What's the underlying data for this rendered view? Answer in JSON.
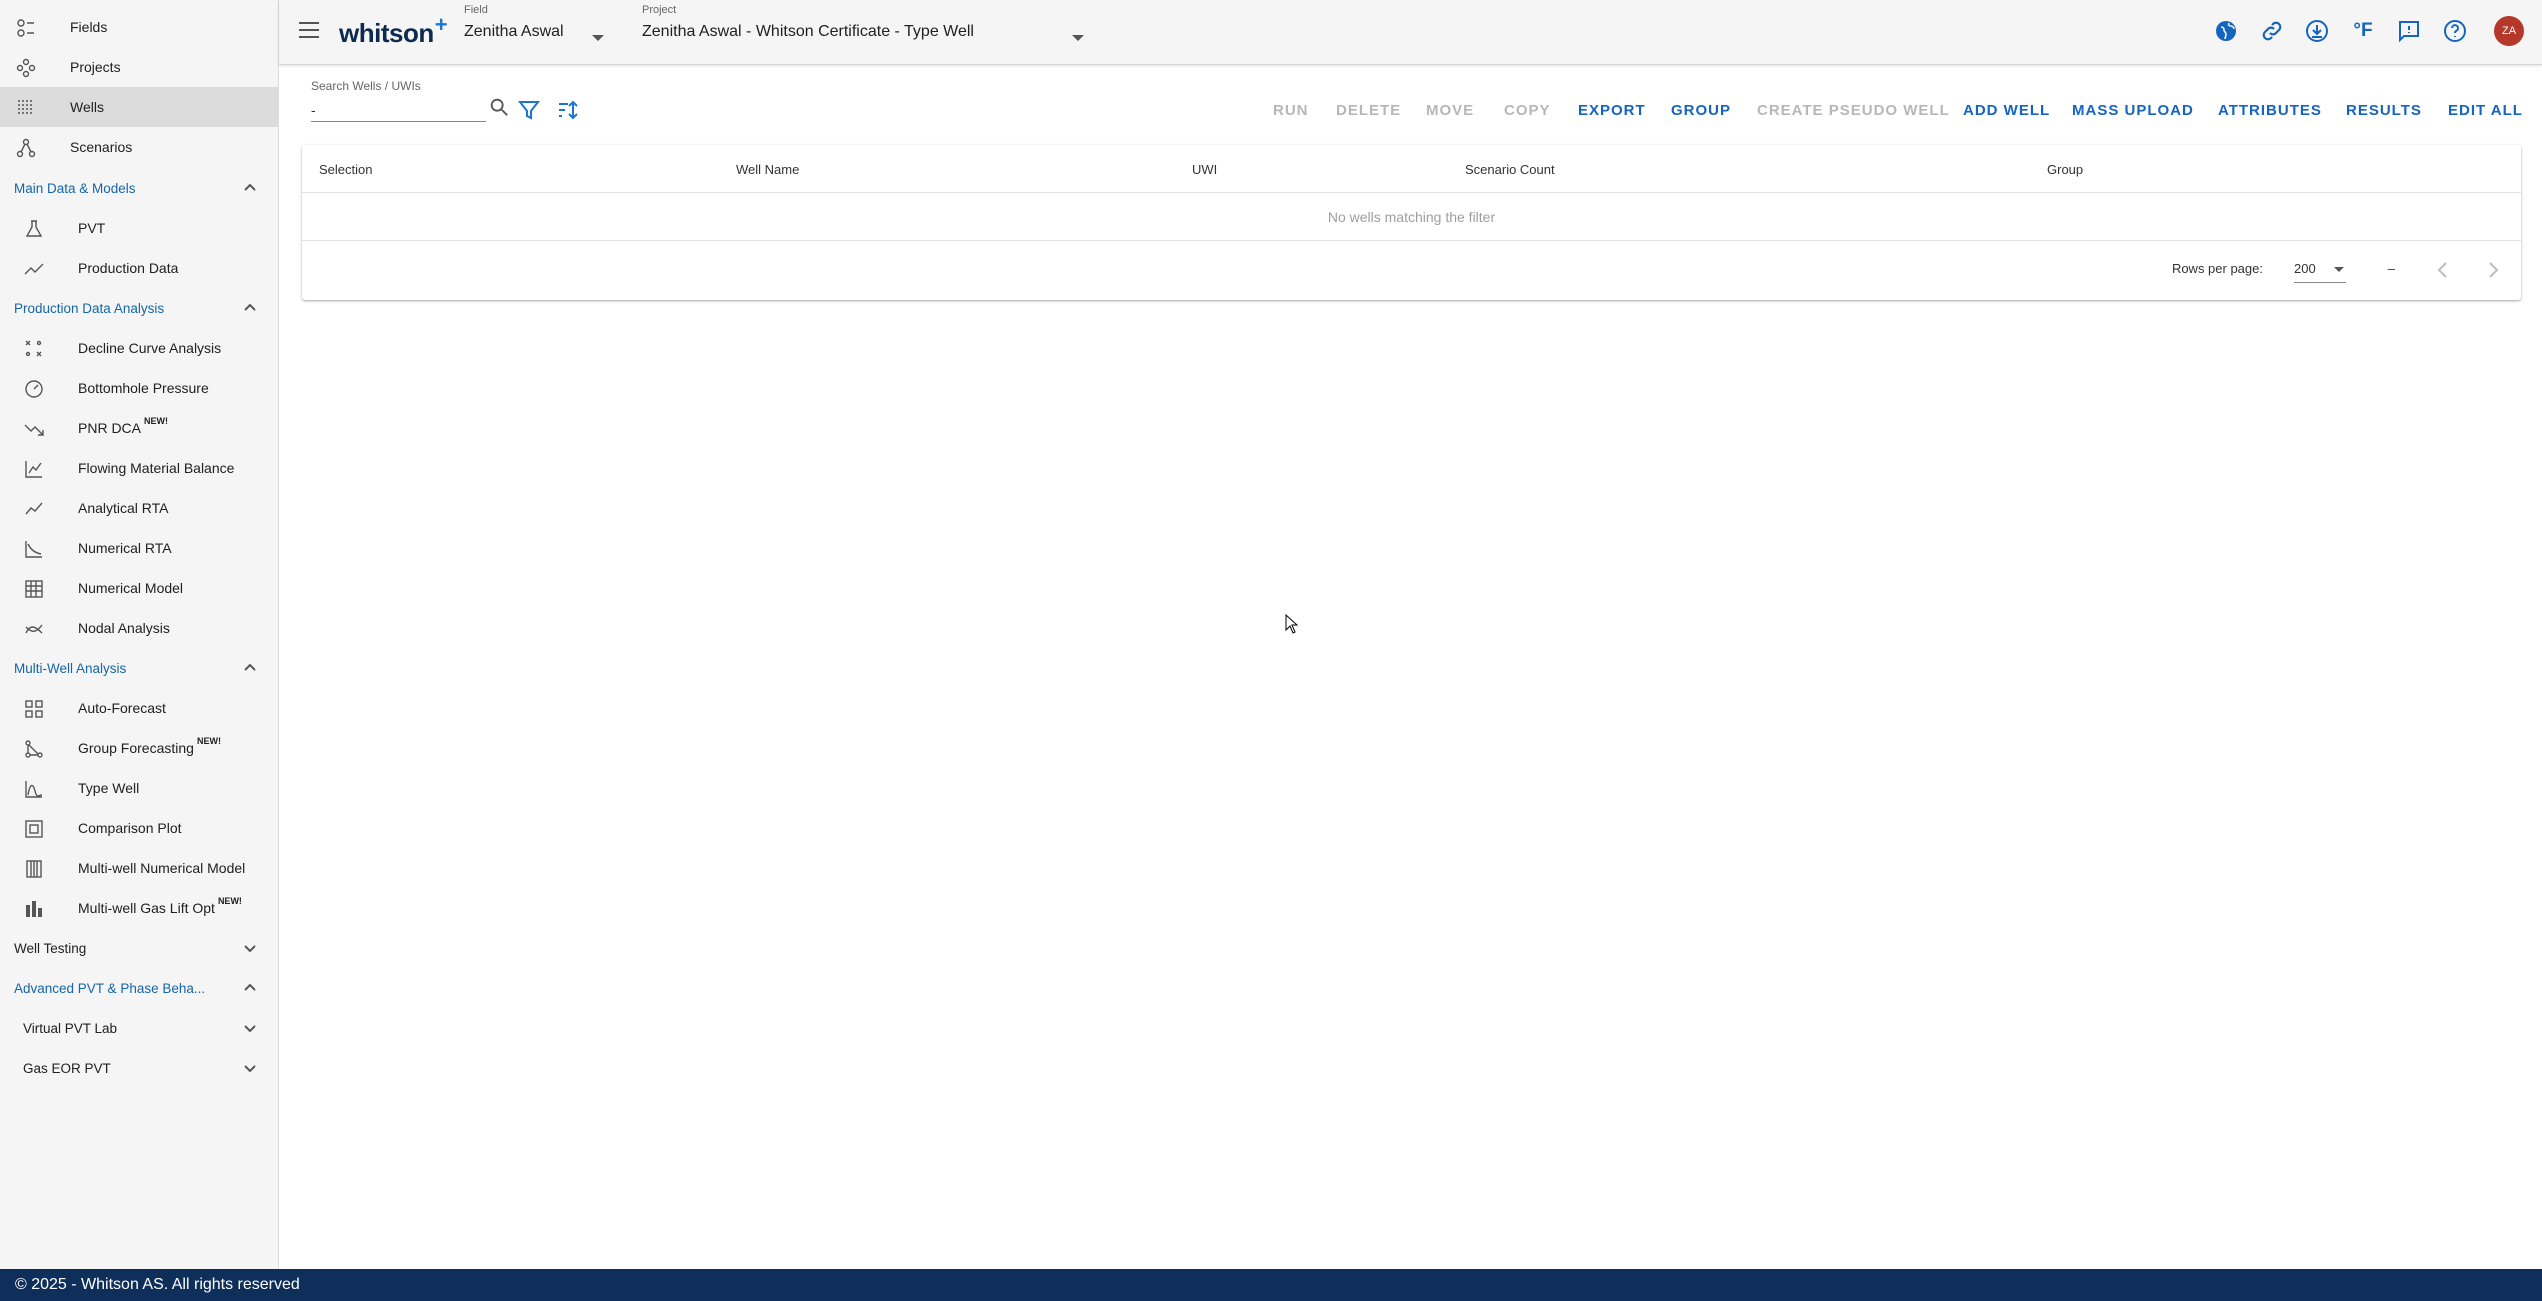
{
  "sidebar": {
    "top_items": [
      {
        "label": "Fields",
        "icon": "fields-icon"
      },
      {
        "label": "Projects",
        "icon": "projects-icon"
      },
      {
        "label": "Wells",
        "icon": "wells-icon",
        "active": true
      },
      {
        "label": "Scenarios",
        "icon": "scenarios-icon"
      }
    ],
    "sections": {
      "main": {
        "title": "Main Data & Models",
        "items": [
          "PVT",
          "Production Data"
        ]
      },
      "pda": {
        "title": "Production Data Analysis",
        "items": [
          "Decline Curve Analysis",
          "Bottomhole Pressure",
          "PNR DCA",
          "Flowing Material Balance",
          "Analytical RTA",
          "Numerical RTA",
          "Numerical Model",
          "Nodal Analysis"
        ]
      },
      "mwa": {
        "title": "Multi-Well Analysis",
        "items": [
          "Auto-Forecast",
          "Group Forecasting",
          "Type Well",
          "Comparison Plot",
          "Multi-well Numerical Model",
          "Multi-well Gas Lift Opt"
        ]
      },
      "well_testing": {
        "title": "Well Testing"
      },
      "adv_pvt": {
        "title": "Advanced PVT & Phase Beha..."
      },
      "virtual_pvt": {
        "title": "Virtual PVT Lab"
      },
      "gas_eor": {
        "title": "Gas EOR PVT"
      }
    },
    "new_badge": "NEW!"
  },
  "header": {
    "logo": "whitson",
    "logo_plus": "+",
    "field_label": "Field",
    "field_value": "Zenitha Aswal",
    "project_label": "Project",
    "project_value": "Zenitha Aswal - Whitson Certificate - Type Well",
    "temp_unit": "°F",
    "avatar": "ZA"
  },
  "toolbar": {
    "search_label": "Search Wells / UWIs",
    "search_value": "-",
    "actions": [
      {
        "label": "RUN",
        "enabled": false
      },
      {
        "label": "DELETE",
        "enabled": false
      },
      {
        "label": "MOVE",
        "enabled": false
      },
      {
        "label": "COPY",
        "enabled": false
      },
      {
        "label": "EXPORT",
        "enabled": true
      },
      {
        "label": "GROUP",
        "enabled": true
      },
      {
        "label": "CREATE PSEUDO WELL",
        "enabled": false
      },
      {
        "label": "ADD WELL",
        "enabled": true
      },
      {
        "label": "MASS UPLOAD",
        "enabled": true
      },
      {
        "label": "ATTRIBUTES",
        "enabled": true
      },
      {
        "label": "RESULTS",
        "enabled": true
      },
      {
        "label": "EDIT ALL",
        "enabled": true
      }
    ]
  },
  "table": {
    "columns": [
      "Selection",
      "Well Name",
      "UWI",
      "Scenario Count",
      "Group"
    ],
    "empty_message": "No wells matching the filter",
    "rows_per_page_label": "Rows per page:",
    "rows_per_page": "200",
    "range": "–"
  },
  "footer": {
    "text": "© 2025 - Whitson AS. All rights reserved"
  },
  "colors": {
    "accent": "#1565c0",
    "footer_bg": "#0e2f5a",
    "avatar_bg": "#b5382b",
    "section_title": "#1565a8"
  }
}
